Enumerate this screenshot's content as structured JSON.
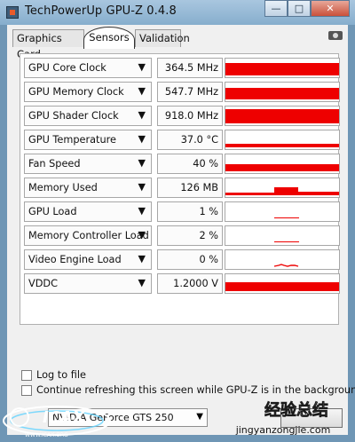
{
  "window": {
    "title": "TechPowerUp GPU-Z 0.4.8"
  },
  "tabs": [
    {
      "label": "Graphics Card",
      "active": false
    },
    {
      "label": "Sensors",
      "active": true
    },
    {
      "label": "Validation",
      "active": false
    }
  ],
  "sensors": [
    {
      "label": "GPU Core Clock",
      "value": "364.5 MHz",
      "graph": "full"
    },
    {
      "label": "GPU Memory Clock",
      "value": "547.7 MHz",
      "graph": "full"
    },
    {
      "label": "GPU Shader Clock",
      "value": "918.0 MHz",
      "graph": "full"
    },
    {
      "label": "GPU Temperature",
      "value": "37.0 °C",
      "graph": "low"
    },
    {
      "label": "Fan Speed",
      "value": "40 %",
      "graph": "mid"
    },
    {
      "label": "Memory Used",
      "value": "126 MB",
      "graph": "memory"
    },
    {
      "label": "GPU Load",
      "value": "1 %",
      "graph": "tiny"
    },
    {
      "label": "Memory Controller Load",
      "value": "2 %",
      "graph": "tiny"
    },
    {
      "label": "Video Engine Load",
      "value": "0 %",
      "graph": "spike"
    },
    {
      "label": "VDDC",
      "value": "1.2000 V",
      "graph": "full"
    }
  ],
  "options": {
    "log_to_file": "Log to file",
    "continue_refreshing": "Continue refreshing this screen while GPU-Z is in the background"
  },
  "gpu_selector": {
    "value": "NVIDIA GeForce GTS 250"
  },
  "logo": {
    "text": "ICAX",
    "subtext": "WWW.ICAX.ORG"
  },
  "watermark": {
    "cn": "经验总结",
    "url": "jingyanzongjie.com"
  },
  "colors": {
    "graph": "#ee0000",
    "titlebar": "#8fb4d3"
  }
}
